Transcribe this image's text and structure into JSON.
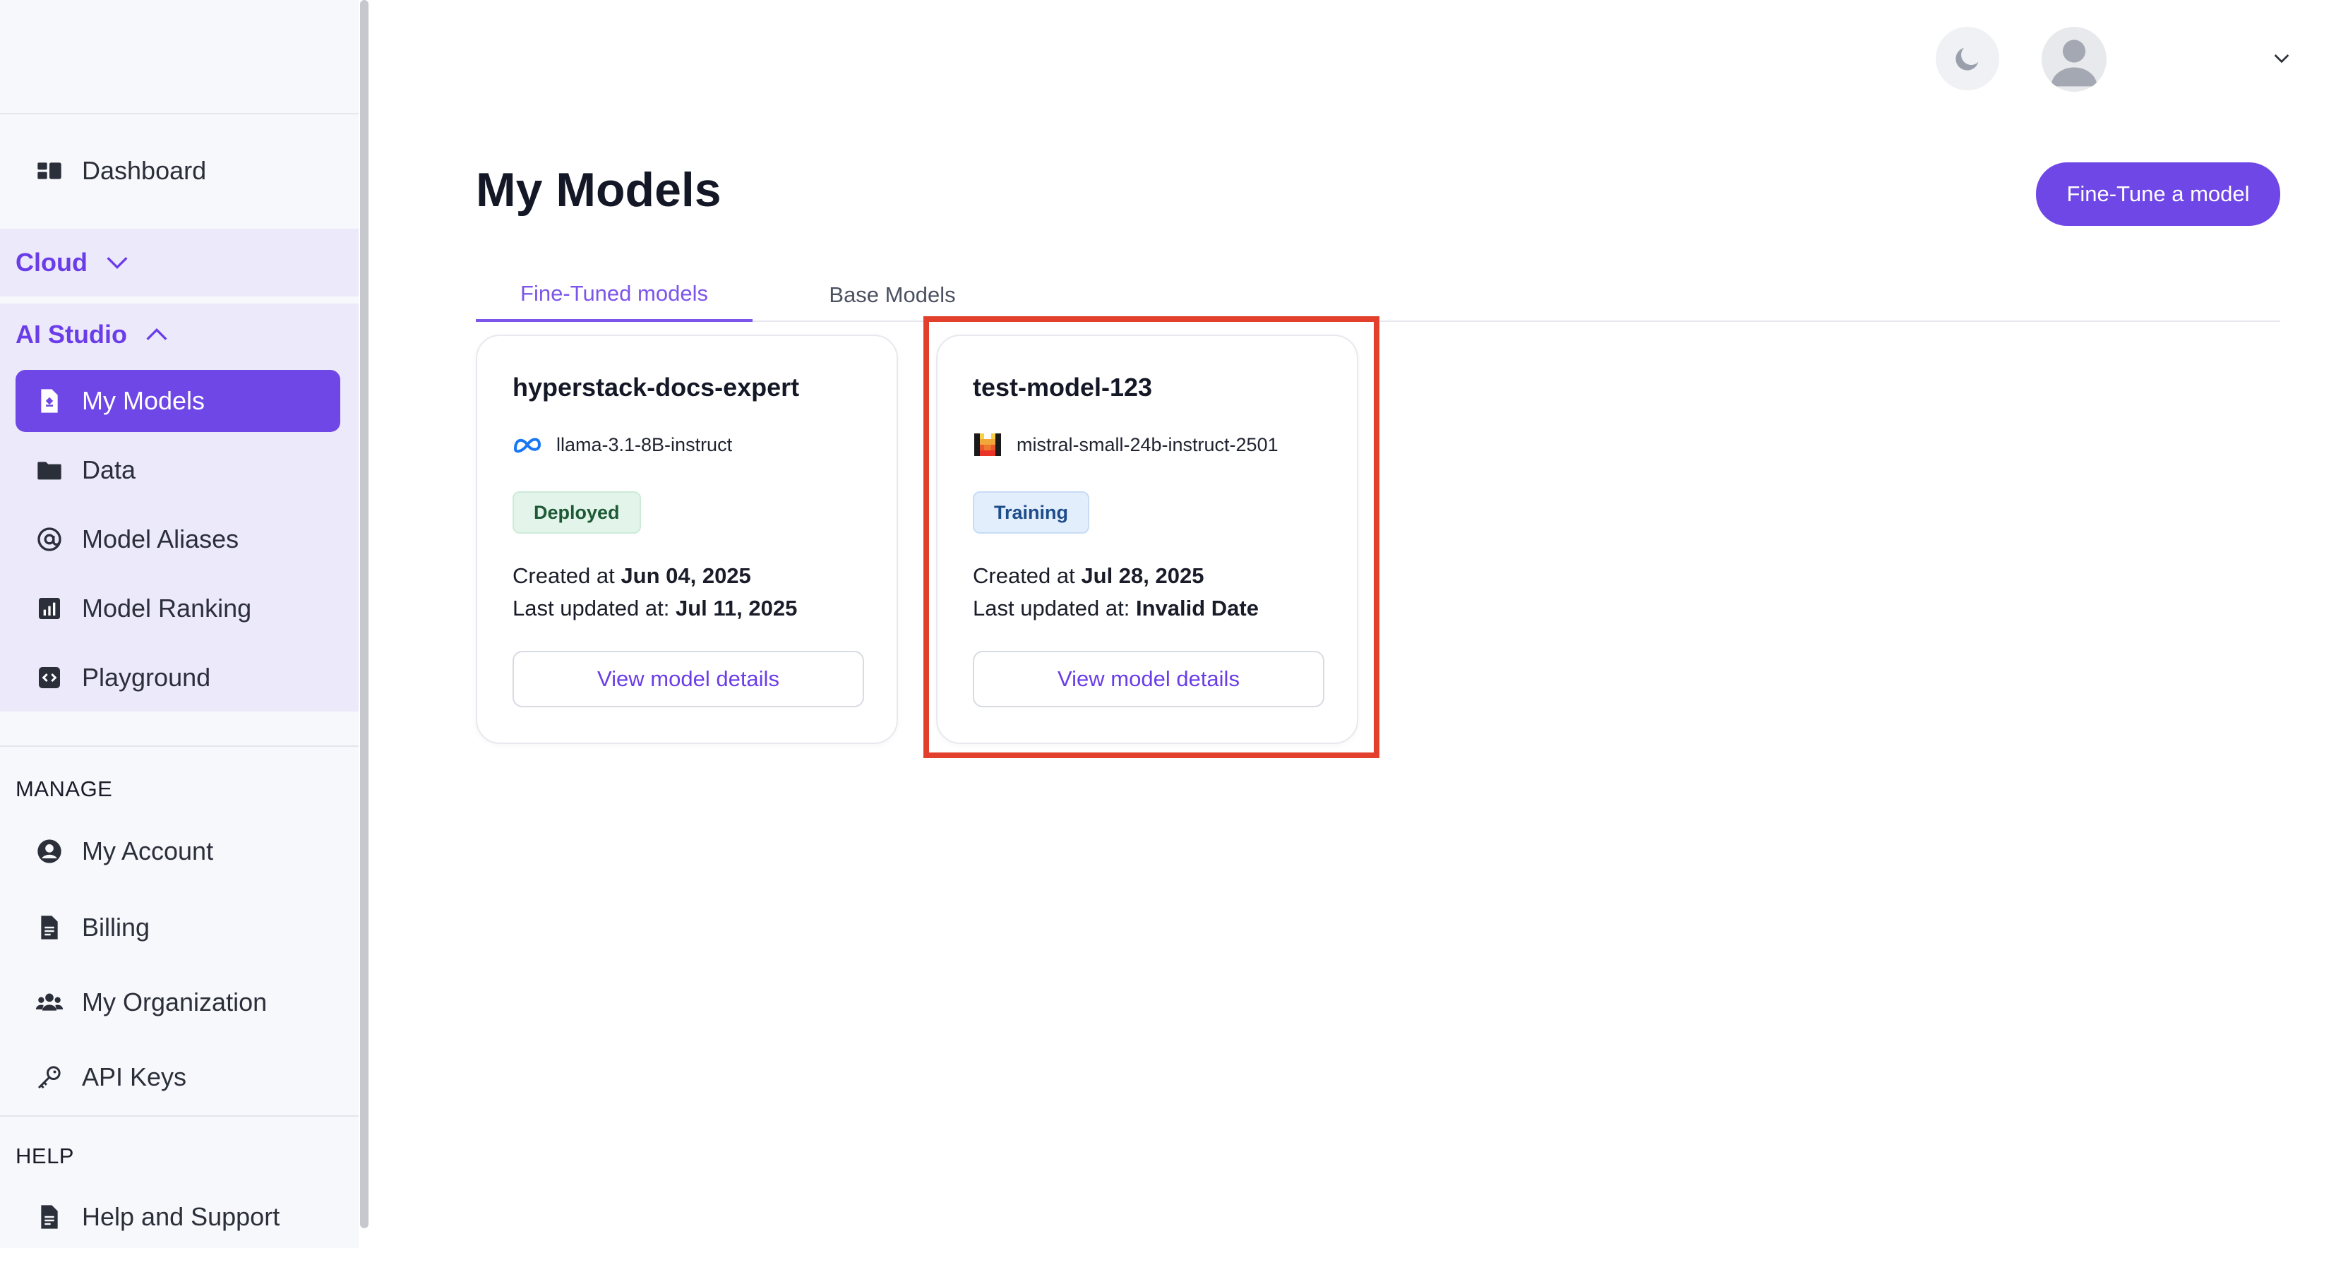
{
  "sidebar": {
    "dashboard_label": "Dashboard",
    "cloud_label": "Cloud",
    "ai_studio_label": "AI Studio",
    "ai_studio_items": [
      {
        "label": "My Models",
        "icon": "model-file-icon",
        "active": true
      },
      {
        "label": "Data",
        "icon": "folder-icon"
      },
      {
        "label": "Model Aliases",
        "icon": "at-sign-icon"
      },
      {
        "label": "Model Ranking",
        "icon": "bar-chart-icon"
      },
      {
        "label": "Playground",
        "icon": "code-icon"
      }
    ],
    "manage_label": "MANAGE",
    "manage_items": [
      {
        "label": "My Account",
        "icon": "user-circle-icon"
      },
      {
        "label": "Billing",
        "icon": "document-icon"
      },
      {
        "label": "My Organization",
        "icon": "users-icon"
      },
      {
        "label": "API Keys",
        "icon": "key-icon"
      }
    ],
    "help_label": "HELP",
    "help_items": [
      {
        "label": "Help and Support",
        "icon": "document-icon"
      }
    ]
  },
  "header": {
    "theme_icon": "moon-icon",
    "avatar_icon": "user-avatar-icon"
  },
  "main": {
    "title": "My Models",
    "finetune_button": "Fine-Tune a model",
    "tabs": [
      {
        "label": "Fine-Tuned models",
        "active": true
      },
      {
        "label": "Base Models",
        "active": false
      }
    ],
    "models": [
      {
        "name": "hyperstack-docs-expert",
        "base_model": "llama-3.1-8B-instruct",
        "base_icon": "meta-logo-icon",
        "status": "Deployed",
        "created_prefix": "Created at",
        "created": "Jun 04, 2025",
        "updated_prefix": "Last updated at:",
        "updated": "Jul 11, 2025",
        "button": "View model details"
      },
      {
        "name": "test-model-123",
        "base_model": "mistral-small-24b-instruct-2501",
        "base_icon": "mistral-logo-icon",
        "status": "Training",
        "created_prefix": "Created at",
        "created": "Jul 28, 2025",
        "updated_prefix": "Last updated at:",
        "updated": "Invalid Date",
        "button": "View model details"
      }
    ]
  },
  "colors": {
    "accent": "#6f47e6",
    "highlight": "#e2402c",
    "deployed_bg": "#e3f5ea",
    "training_bg": "#e3eefc"
  }
}
